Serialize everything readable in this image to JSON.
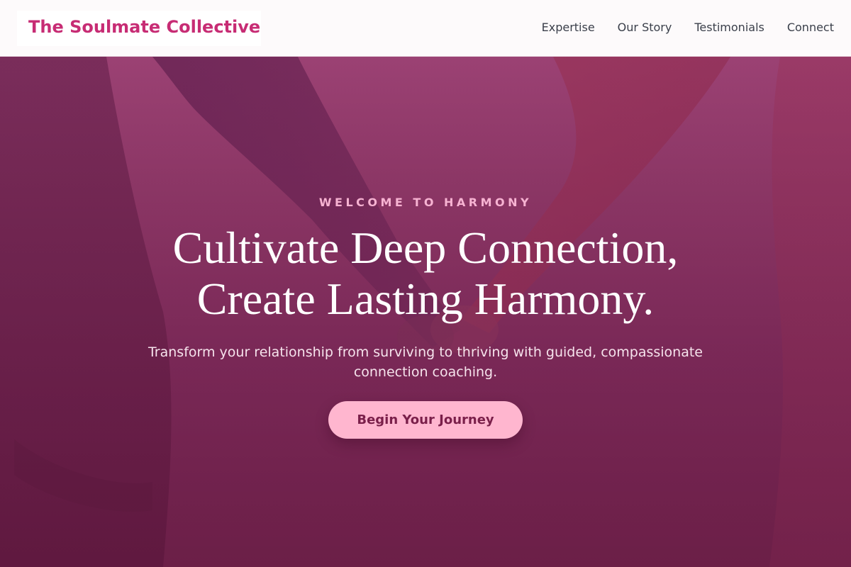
{
  "brand": {
    "name": "The Soulmate Collective"
  },
  "nav": {
    "links": [
      "Expertise",
      "Our Story",
      "Testimonials",
      "Connect"
    ]
  },
  "hero": {
    "eyebrow": "WELCOME TO HARMONY",
    "headline_line1": "Cultivate Deep Connection,",
    "headline_line2": "Create Lasting Harmony.",
    "subtext": "Transform your relationship from surviving to thriving with guided, compassionate connection coaching.",
    "cta_label": "Begin Your Journey",
    "background_image": "couple-holding-hands-photo"
  },
  "colors": {
    "brand_accent": "#c72c74",
    "cta_background": "#ffb6cf",
    "cta_text": "#7a1f4a",
    "eyebrow": "#f7b3d2",
    "hero_tint": "#7a2c5a"
  }
}
